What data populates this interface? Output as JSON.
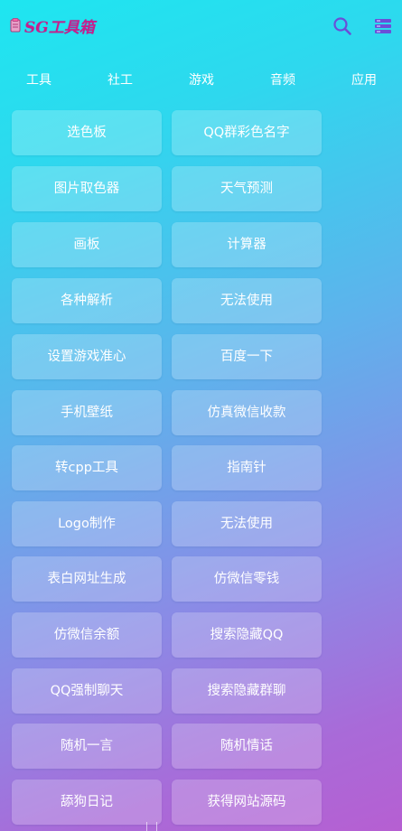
{
  "header": {
    "app_title": "SG工具箱",
    "app_icon": "toolbox-icon",
    "search_icon": "search-icon",
    "menu_icon": "menu-icon"
  },
  "tabs": [
    {
      "label": "工具"
    },
    {
      "label": "社工"
    },
    {
      "label": "游戏"
    },
    {
      "label": "音频"
    },
    {
      "label": "应用"
    }
  ],
  "tools": [
    {
      "label": "选色板"
    },
    {
      "label": "QQ群彩色名字"
    },
    {
      "label": "图片取色器"
    },
    {
      "label": "天气预测"
    },
    {
      "label": "画板"
    },
    {
      "label": "计算器"
    },
    {
      "label": "各种解析"
    },
    {
      "label": "无法使用"
    },
    {
      "label": "设置游戏准心"
    },
    {
      "label": "百度一下"
    },
    {
      "label": "手机壁纸"
    },
    {
      "label": "仿真微信收款"
    },
    {
      "label": "转cpp工具"
    },
    {
      "label": "指南针"
    },
    {
      "label": "Logo制作"
    },
    {
      "label": "无法使用"
    },
    {
      "label": "表白网址生成"
    },
    {
      "label": "仿微信零钱"
    },
    {
      "label": "仿微信余额"
    },
    {
      "label": "搜索隐藏QQ"
    },
    {
      "label": "QQ强制聊天"
    },
    {
      "label": "搜索隐藏群聊"
    },
    {
      "label": "随机一言"
    },
    {
      "label": "随机情话"
    },
    {
      "label": "舔狗日记"
    },
    {
      "label": "获得网站源码"
    }
  ],
  "colors": {
    "title": "#c81e8c",
    "text": "#ffffff",
    "gradient_top": "#1ee6f0",
    "gradient_bottom": "#b65fd2"
  }
}
